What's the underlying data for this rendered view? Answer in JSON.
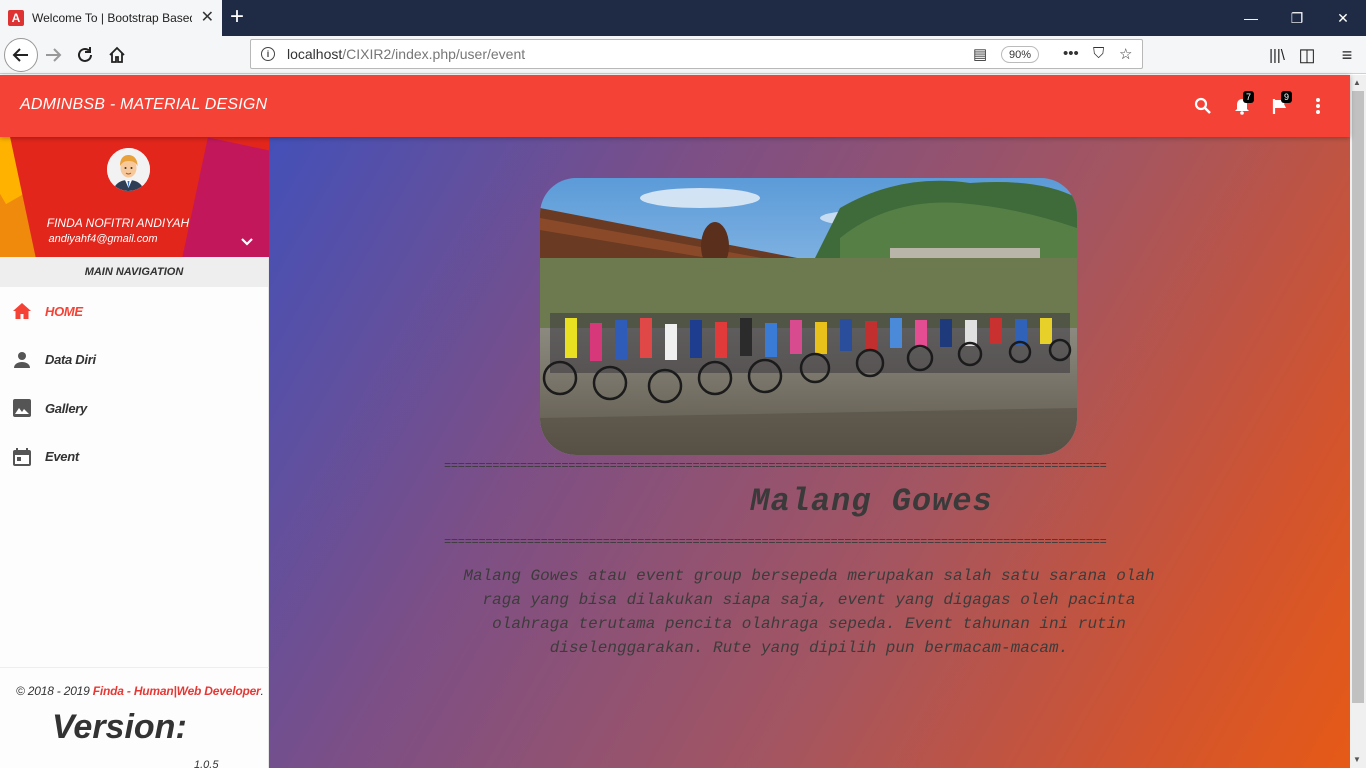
{
  "browser": {
    "tab_title": "Welcome To | Bootstrap Based",
    "url_host": "localhost",
    "url_path": "/CIXIR2/index.php/user/event",
    "zoom": "90%"
  },
  "header": {
    "brand": "ADMINBSB - MATERIAL DESIGN",
    "notifications_count": "7",
    "tasks_count": "9"
  },
  "user": {
    "name": "FINDA NOFITRI ANDIYAH",
    "email": "andiyahf4@gmail.com"
  },
  "sidebar": {
    "nav_header": "MAIN NAVIGATION",
    "items": [
      {
        "label": "HOME",
        "icon": "home-icon",
        "active": true
      },
      {
        "label": "Data Diri",
        "icon": "person-icon",
        "active": false
      },
      {
        "label": "Gallery",
        "icon": "image-icon",
        "active": false
      },
      {
        "label": "Event",
        "icon": "calendar-icon",
        "active": false
      }
    ]
  },
  "footer": {
    "copyright_prefix": "© 2018 - 2019 ",
    "copyright_link": "Finda - Human|Web Developer",
    "copyright_suffix": ".",
    "version_label": "Version:",
    "version_number": "1.0.5"
  },
  "event": {
    "divider": "================================================================================================",
    "title": "Malang Gowes",
    "description": "Malang Gowes atau event group bersepeda merupakan salah satu sarana olah raga yang bisa dilakukan siapa saja, event yang digagas oleh pacinta olahraga terutama pencita olahraga sepeda. Event tahunan ini rutin diselenggarakan. Rute yang dipilih pun bermacam-macam."
  },
  "colors": {
    "header": "#f44336",
    "active_menu": "#f44336",
    "text": "#333333"
  }
}
